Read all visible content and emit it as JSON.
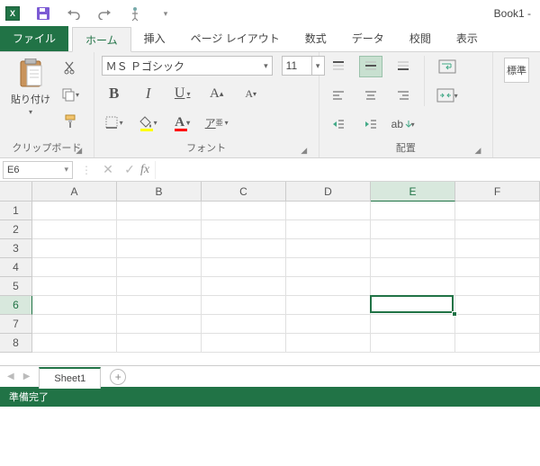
{
  "title": "Book1 -",
  "tabs": {
    "file": "ファイル",
    "home": "ホーム",
    "insert": "挿入",
    "layout": "ページ レイアウト",
    "formulas": "数式",
    "data": "データ",
    "review": "校閲",
    "view": "表示"
  },
  "clipboard": {
    "paste_label": "貼り付け",
    "group_label": "クリップボード"
  },
  "font": {
    "name": "ＭＳ Ｐゴシック",
    "size": "11",
    "group_label": "フォント",
    "bold": "B",
    "italic": "I",
    "underline": "U",
    "grow": "A",
    "shrink": "A",
    "font_color_letter": "A",
    "fill_icon": "A",
    "phonetic": "ア"
  },
  "alignment": {
    "group_label": "配置"
  },
  "styles": {
    "label": "標準"
  },
  "namebox": "E6",
  "fx": "fx",
  "columns": [
    "A",
    "B",
    "C",
    "D",
    "E",
    "F"
  ],
  "rows": [
    "1",
    "2",
    "3",
    "4",
    "5",
    "6",
    "7",
    "8"
  ],
  "selected_col": 4,
  "selected_row": 5,
  "sheet": "Sheet1",
  "status": "準備完了"
}
